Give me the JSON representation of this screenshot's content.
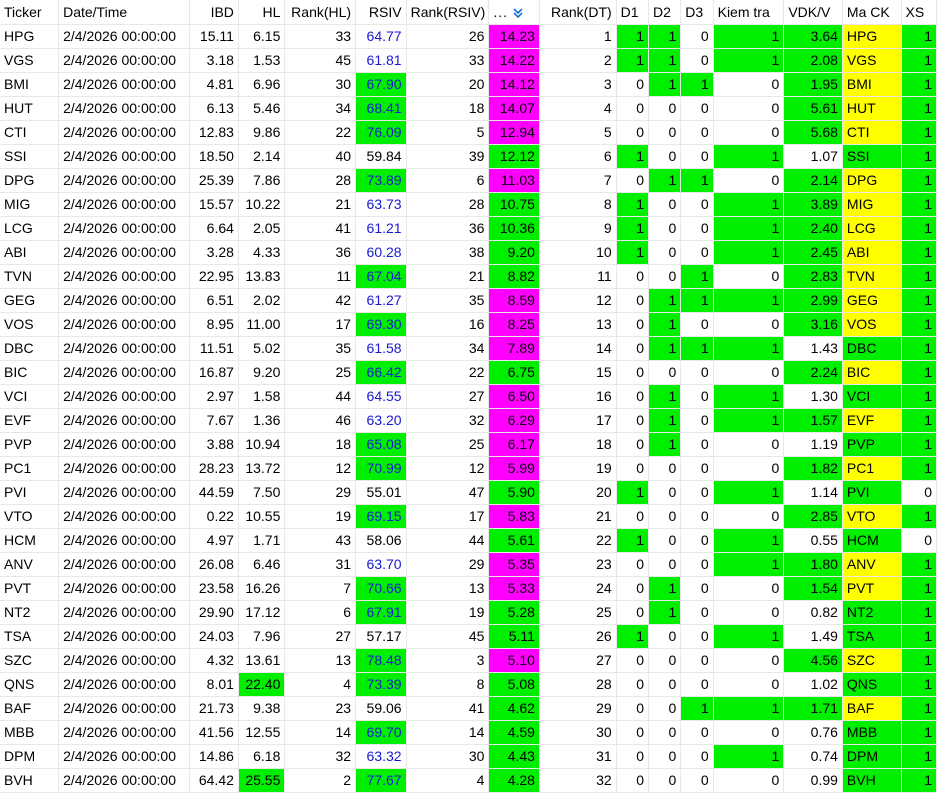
{
  "columns": [
    {
      "key": "ticker",
      "label": "Ticker"
    },
    {
      "key": "dt",
      "label": "Date/Time"
    },
    {
      "key": "ibd",
      "label": "IBD"
    },
    {
      "key": "hl",
      "label": "HL"
    },
    {
      "key": "rank_hl",
      "label": "Rank(HL)"
    },
    {
      "key": "rsiv",
      "label": "RSIV"
    },
    {
      "key": "rank_rsiv",
      "label": "Rank(RSIV)"
    },
    {
      "key": "dt_val",
      "label": "..."
    },
    {
      "key": "rank_dt",
      "label": "Rank(DT)"
    },
    {
      "key": "d1",
      "label": "D1"
    },
    {
      "key": "d2",
      "label": "D2"
    },
    {
      "key": "d3",
      "label": "D3"
    },
    {
      "key": "kiem_tra",
      "label": "Kiem tra"
    },
    {
      "key": "vdk_v",
      "label": "VDK/V"
    },
    {
      "key": "ma_ck",
      "label": "Ma CK"
    },
    {
      "key": "xs",
      "label": "XS"
    }
  ],
  "sort_icon": "sort-descending-icon",
  "colors": {
    "green": "#00ee00",
    "yellow": "#ffff00",
    "magenta": "#ff00ff",
    "blue_text": "#1a1ad6"
  },
  "rows": [
    [
      "HPG",
      "2/4/2026 00:00:00",
      "15.11",
      "6.15",
      "33",
      "64.77",
      "26",
      "14.23",
      "1",
      "1",
      "1",
      "0",
      "1",
      "3.64",
      "HPG",
      "1"
    ],
    [
      "VGS",
      "2/4/2026 00:00:00",
      "3.18",
      "1.53",
      "45",
      "61.81",
      "33",
      "14.22",
      "2",
      "1",
      "1",
      "0",
      "1",
      "2.08",
      "VGS",
      "1"
    ],
    [
      "BMI",
      "2/4/2026 00:00:00",
      "4.81",
      "6.96",
      "30",
      "67.90",
      "20",
      "14.12",
      "3",
      "0",
      "1",
      "1",
      "0",
      "1.95",
      "BMI",
      "1"
    ],
    [
      "HUT",
      "2/4/2026 00:00:00",
      "6.13",
      "5.46",
      "34",
      "68.41",
      "18",
      "14.07",
      "4",
      "0",
      "0",
      "0",
      "0",
      "5.61",
      "HUT",
      "1"
    ],
    [
      "CTI",
      "2/4/2026 00:00:00",
      "12.83",
      "9.86",
      "22",
      "76.09",
      "5",
      "12.94",
      "5",
      "0",
      "0",
      "0",
      "0",
      "5.68",
      "CTI",
      "1"
    ],
    [
      "SSI",
      "2/4/2026 00:00:00",
      "18.50",
      "2.14",
      "40",
      "59.84",
      "39",
      "12.12",
      "6",
      "1",
      "0",
      "0",
      "1",
      "1.07",
      "SSI",
      "1"
    ],
    [
      "DPG",
      "2/4/2026 00:00:00",
      "25.39",
      "7.86",
      "28",
      "73.89",
      "6",
      "11.03",
      "7",
      "0",
      "1",
      "1",
      "0",
      "2.14",
      "DPG",
      "1"
    ],
    [
      "MIG",
      "2/4/2026 00:00:00",
      "15.57",
      "10.22",
      "21",
      "63.73",
      "28",
      "10.75",
      "8",
      "1",
      "0",
      "0",
      "1",
      "3.89",
      "MIG",
      "1"
    ],
    [
      "LCG",
      "2/4/2026 00:00:00",
      "6.64",
      "2.05",
      "41",
      "61.21",
      "36",
      "10.36",
      "9",
      "1",
      "0",
      "0",
      "1",
      "2.40",
      "LCG",
      "1"
    ],
    [
      "ABI",
      "2/4/2026 00:00:00",
      "3.28",
      "4.33",
      "36",
      "60.28",
      "38",
      "9.20",
      "10",
      "1",
      "0",
      "0",
      "1",
      "2.45",
      "ABI",
      "1"
    ],
    [
      "TVN",
      "2/4/2026 00:00:00",
      "22.95",
      "13.83",
      "11",
      "67.04",
      "21",
      "8.82",
      "11",
      "0",
      "0",
      "1",
      "0",
      "2.83",
      "TVN",
      "1"
    ],
    [
      "GEG",
      "2/4/2026 00:00:00",
      "6.51",
      "2.02",
      "42",
      "61.27",
      "35",
      "8.59",
      "12",
      "0",
      "1",
      "1",
      "1",
      "2.99",
      "GEG",
      "1"
    ],
    [
      "VOS",
      "2/4/2026 00:00:00",
      "8.95",
      "11.00",
      "17",
      "69.30",
      "16",
      "8.25",
      "13",
      "0",
      "1",
      "0",
      "0",
      "3.16",
      "VOS",
      "1"
    ],
    [
      "DBC",
      "2/4/2026 00:00:00",
      "11.51",
      "5.02",
      "35",
      "61.58",
      "34",
      "7.89",
      "14",
      "0",
      "1",
      "1",
      "1",
      "1.43",
      "DBC",
      "1"
    ],
    [
      "BIC",
      "2/4/2026 00:00:00",
      "16.87",
      "9.20",
      "25",
      "66.42",
      "22",
      "6.75",
      "15",
      "0",
      "0",
      "0",
      "0",
      "2.24",
      "BIC",
      "1"
    ],
    [
      "VCI",
      "2/4/2026 00:00:00",
      "2.97",
      "1.58",
      "44",
      "64.55",
      "27",
      "6.50",
      "16",
      "0",
      "1",
      "0",
      "1",
      "1.30",
      "VCI",
      "1"
    ],
    [
      "EVF",
      "2/4/2026 00:00:00",
      "7.67",
      "1.36",
      "46",
      "63.20",
      "32",
      "6.29",
      "17",
      "0",
      "1",
      "0",
      "1",
      "1.57",
      "EVF",
      "1"
    ],
    [
      "PVP",
      "2/4/2026 00:00:00",
      "3.88",
      "10.94",
      "18",
      "65.08",
      "25",
      "6.17",
      "18",
      "0",
      "1",
      "0",
      "0",
      "1.19",
      "PVP",
      "1"
    ],
    [
      "PC1",
      "2/4/2026 00:00:00",
      "28.23",
      "13.72",
      "12",
      "70.99",
      "12",
      "5.99",
      "19",
      "0",
      "0",
      "0",
      "0",
      "1.82",
      "PC1",
      "1"
    ],
    [
      "PVI",
      "2/4/2026 00:00:00",
      "44.59",
      "7.50",
      "29",
      "55.01",
      "47",
      "5.90",
      "20",
      "1",
      "0",
      "0",
      "1",
      "1.14",
      "PVI",
      "0"
    ],
    [
      "VTO",
      "2/4/2026 00:00:00",
      "0.22",
      "10.55",
      "19",
      "69.15",
      "17",
      "5.83",
      "21",
      "0",
      "0",
      "0",
      "0",
      "2.85",
      "VTO",
      "1"
    ],
    [
      "HCM",
      "2/4/2026 00:00:00",
      "4.97",
      "1.71",
      "43",
      "58.06",
      "44",
      "5.61",
      "22",
      "1",
      "0",
      "0",
      "1",
      "0.55",
      "HCM",
      "0"
    ],
    [
      "ANV",
      "2/4/2026 00:00:00",
      "26.08",
      "6.46",
      "31",
      "63.70",
      "29",
      "5.35",
      "23",
      "0",
      "0",
      "0",
      "1",
      "1.80",
      "ANV",
      "1"
    ],
    [
      "PVT",
      "2/4/2026 00:00:00",
      "23.58",
      "16.26",
      "7",
      "70.66",
      "13",
      "5.33",
      "24",
      "0",
      "1",
      "0",
      "0",
      "1.54",
      "PVT",
      "1"
    ],
    [
      "NT2",
      "2/4/2026 00:00:00",
      "29.90",
      "17.12",
      "6",
      "67.91",
      "19",
      "5.28",
      "25",
      "0",
      "1",
      "0",
      "0",
      "0.82",
      "NT2",
      "1"
    ],
    [
      "TSA",
      "2/4/2026 00:00:00",
      "24.03",
      "7.96",
      "27",
      "57.17",
      "45",
      "5.11",
      "26",
      "1",
      "0",
      "0",
      "1",
      "1.49",
      "TSA",
      "1"
    ],
    [
      "SZC",
      "2/4/2026 00:00:00",
      "4.32",
      "13.61",
      "13",
      "78.48",
      "3",
      "5.10",
      "27",
      "0",
      "0",
      "0",
      "0",
      "4.56",
      "SZC",
      "1"
    ],
    [
      "QNS",
      "2/4/2026 00:00:00",
      "8.01",
      "22.40",
      "4",
      "73.39",
      "8",
      "5.08",
      "28",
      "0",
      "0",
      "0",
      "0",
      "1.02",
      "QNS",
      "1"
    ],
    [
      "BAF",
      "2/4/2026 00:00:00",
      "21.73",
      "9.38",
      "23",
      "59.06",
      "41",
      "4.62",
      "29",
      "0",
      "0",
      "1",
      "1",
      "1.71",
      "BAF",
      "1"
    ],
    [
      "MBB",
      "2/4/2026 00:00:00",
      "41.56",
      "12.55",
      "14",
      "69.70",
      "14",
      "4.59",
      "30",
      "0",
      "0",
      "0",
      "0",
      "0.76",
      "MBB",
      "1"
    ],
    [
      "DPM",
      "2/4/2026 00:00:00",
      "14.86",
      "6.18",
      "32",
      "63.32",
      "30",
      "4.43",
      "31",
      "0",
      "0",
      "0",
      "1",
      "0.74",
      "DPM",
      "1"
    ],
    [
      "BVH",
      "2/4/2026 00:00:00",
      "64.42",
      "25.55",
      "2",
      "77.67",
      "4",
      "4.28",
      "32",
      "0",
      "0",
      "0",
      "0",
      "0.99",
      "BVH",
      "1"
    ]
  ]
}
